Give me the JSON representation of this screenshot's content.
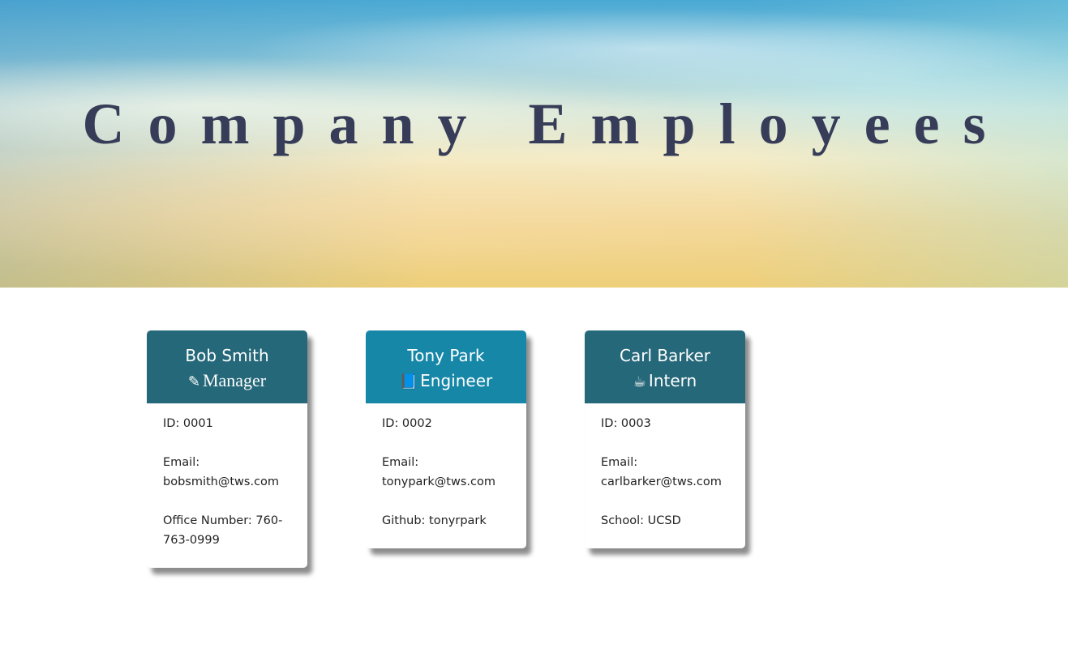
{
  "header": {
    "title": "Company Employees"
  },
  "colors": {
    "manager": "#256879",
    "engineer": "#1787a8",
    "intern": "#256879"
  },
  "employees": [
    {
      "name": "Bob Smith",
      "role": "Manager",
      "icon": "edit-icon",
      "id_line": "ID: 0001",
      "email_label": "Email:",
      "email": "bobsmith@tws.com",
      "extra": "Office Number: 760-763-0999"
    },
    {
      "name": "Tony Park",
      "role": "Engineer",
      "icon": "book-icon",
      "id_line": "ID: 0002",
      "email_label": "Email:",
      "email": "tonypark@tws.com",
      "extra": "Github: tonyrpark"
    },
    {
      "name": "Carl Barker",
      "role": "Intern",
      "icon": "coffee-icon",
      "id_line": "ID: 0003",
      "email_label": "Email:",
      "email": "carlbarker@tws.com",
      "extra": "School: UCSD"
    }
  ]
}
